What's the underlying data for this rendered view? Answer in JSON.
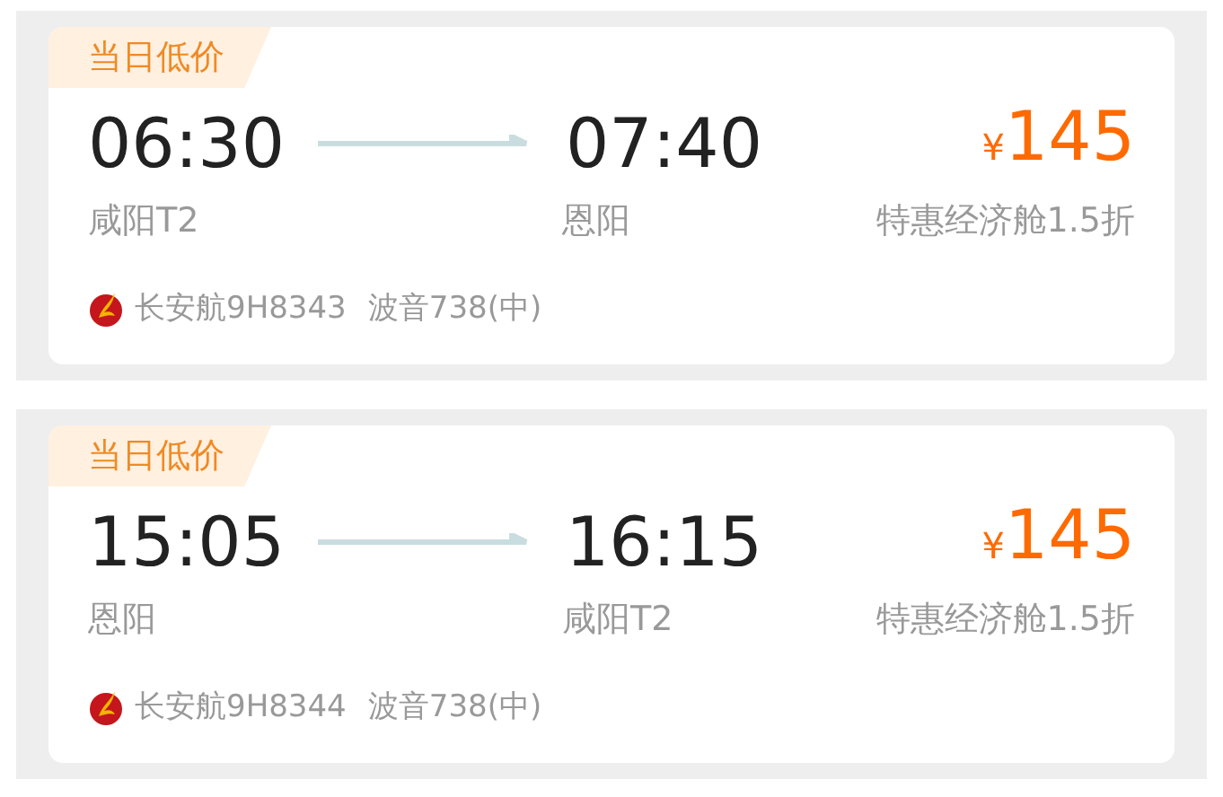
{
  "flights": [
    {
      "badge": "当日低价",
      "depart_time": "06:30",
      "depart_airport": "咸阳T2",
      "arrive_time": "07:40",
      "arrive_airport": "恩阳",
      "currency": "¥",
      "price": "145",
      "cabin": "特惠经济舱1.5折",
      "airline": "长安航9H8343",
      "aircraft": "波音738(中)"
    },
    {
      "badge": "当日低价",
      "depart_time": "15:05",
      "depart_airport": "恩阳",
      "arrive_time": "16:15",
      "arrive_airport": "咸阳T2",
      "currency": "¥",
      "price": "145",
      "cabin": "特惠经济舱1.5折",
      "airline": "长安航9H8344",
      "aircraft": "波音738(中)"
    }
  ]
}
